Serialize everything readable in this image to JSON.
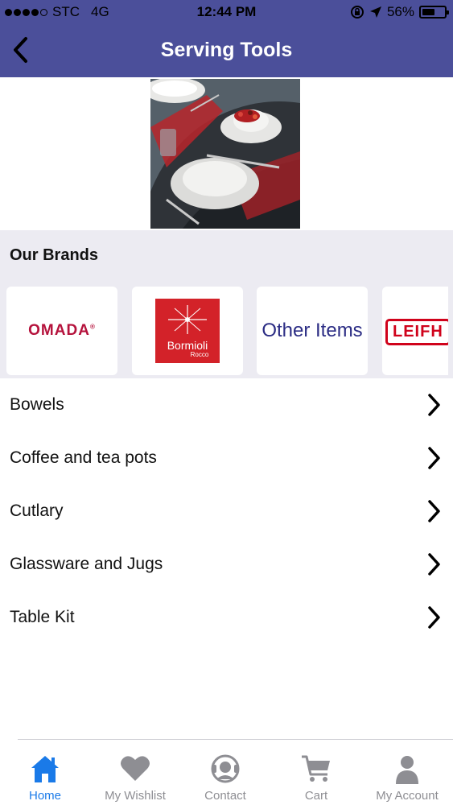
{
  "status_bar": {
    "carrier": "STC",
    "network": "4G",
    "time": "12:44 PM",
    "battery_percent": "56%",
    "battery_level": 0.56
  },
  "nav": {
    "title": "Serving Tools",
    "back_icon": "chevron-left-icon"
  },
  "brands": {
    "heading": "Our Brands",
    "items": [
      {
        "logo_text": "OMADA"
      },
      {
        "logo_text": "Bormioli",
        "logo_subtext": "Rocco"
      },
      {
        "logo_text": "Other Items"
      },
      {
        "logo_text": "LEIFH"
      }
    ]
  },
  "categories": [
    {
      "label": "Bowels"
    },
    {
      "label": "Coffee and tea pots"
    },
    {
      "label": "Cutlary"
    },
    {
      "label": "Glassware and Jugs"
    },
    {
      "label": "Table Kit"
    }
  ],
  "tab_bar": {
    "active": "Home",
    "tabs": [
      {
        "label": "Home",
        "icon": "home-icon"
      },
      {
        "label": "My Wishlist",
        "icon": "heart-icon"
      },
      {
        "label": "Contact",
        "icon": "support-headset-icon"
      },
      {
        "label": "Cart",
        "icon": "cart-icon"
      },
      {
        "label": "My Account",
        "icon": "user-icon"
      }
    ]
  },
  "colors": {
    "header": "#4b4f9a",
    "brands_background": "#ecebf2",
    "active_tab": "#1a7ae8",
    "inactive_tab": "#8e8e93"
  }
}
